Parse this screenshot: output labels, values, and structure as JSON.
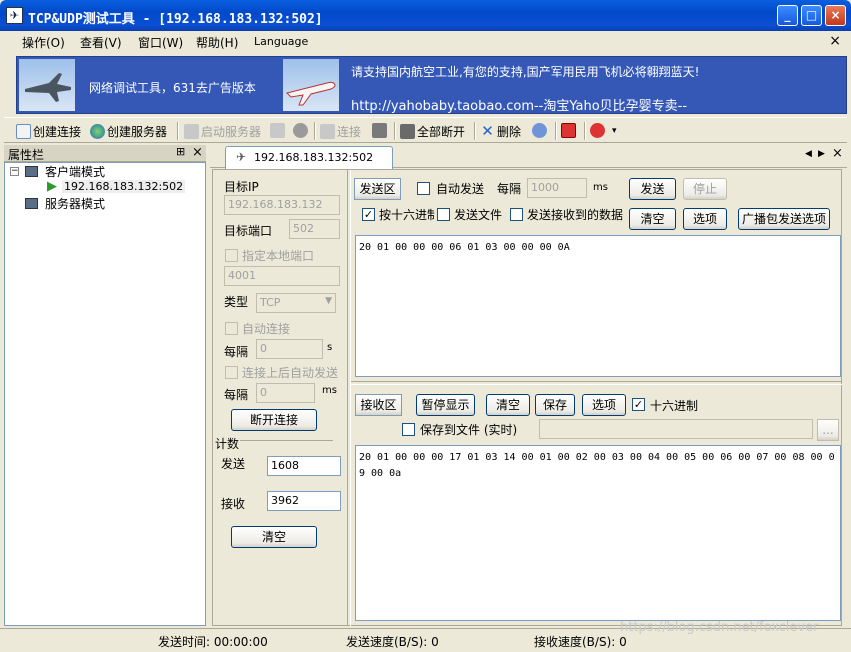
{
  "window": {
    "title": "TCP&UDP测试工具 - [192.168.183.132:502]"
  },
  "menu": {
    "items": [
      "操作(O)",
      "查看(V)",
      "窗口(W)",
      "帮助(H)",
      "Language"
    ],
    "close": "×"
  },
  "banner": {
    "left_text": "网络调试工具，631去广告版本",
    "right_line1": "请支持国内航空工业,有您的支持,国产军用民用飞机必将翱翔蓝天!",
    "right_line2": "http://yahobaby.taobao.com--淘宝Yaho贝比孕婴专卖--"
  },
  "toolbar": {
    "create_conn": "创建连接",
    "create_server": "创建服务器",
    "start_server": "启动服务器",
    "connect": "连接",
    "disconnect_all": "全部断开",
    "delete": "删除"
  },
  "sidebar": {
    "title": "属性栏",
    "pin": "⊞",
    "close": "×",
    "client_mode": "客户端模式",
    "client_conn": "192.168.183.132:502",
    "server_mode": "服务器模式"
  },
  "tab": {
    "label": "192.168.183.132:502"
  },
  "conn": {
    "target_ip_label": "目标IP",
    "target_ip": "192.168.183.132",
    "target_port_label": "目标端口",
    "target_port": "502",
    "local_port_chk": "指定本地端口",
    "local_port": "4001",
    "type_label": "类型",
    "type_value": "TCP",
    "auto_connect": "自动连接",
    "interval_label": "每隔",
    "interval1": "0",
    "interval1_unit": "s",
    "auto_send_after": "连接上后自动发送",
    "interval2": "0",
    "interval2_unit": "ms",
    "disconnect_btn": "断开连接"
  },
  "counter": {
    "title": "计数",
    "send_label": "发送",
    "send_value": "1608",
    "recv_label": "接收",
    "recv_value": "3962",
    "clear_btn": "清空"
  },
  "send": {
    "area_label": "发送区",
    "auto_send": "自动发送",
    "interval_label": "每隔",
    "interval_value": "1000",
    "unit": "ms",
    "send_btn": "发送",
    "stop_btn": "停止",
    "hex_send": "按十六进制",
    "send_file": "发送文件",
    "send_received": "发送接收到的数据",
    "clear_btn": "清空",
    "options_btn": "选项",
    "broadcast_btn": "广播包发送选项",
    "content": "20 01 00 00 00 06 01 03 00 00 00 0A"
  },
  "recv": {
    "area_label": "接收区",
    "pause_btn": "暂停显示",
    "clear_btn": "清空",
    "save_btn": "保存",
    "options_btn": "选项",
    "hex_display": "十六进制",
    "save_to_file": "保存到文件 (实时)",
    "browse_btn": "...",
    "content": "20 01 00 00 00 17 01 03 14 00 01 00 02 00 03 00 04 00 05 00 06 00 07 00 08 00 09 00 0a"
  },
  "status": {
    "send_time": "发送时间: 00:00:00",
    "send_speed": "发送速度(B/S): 0",
    "recv_speed": "接收速度(B/S): 0"
  },
  "watermark": "https://blog.csdn.net/foxclever"
}
